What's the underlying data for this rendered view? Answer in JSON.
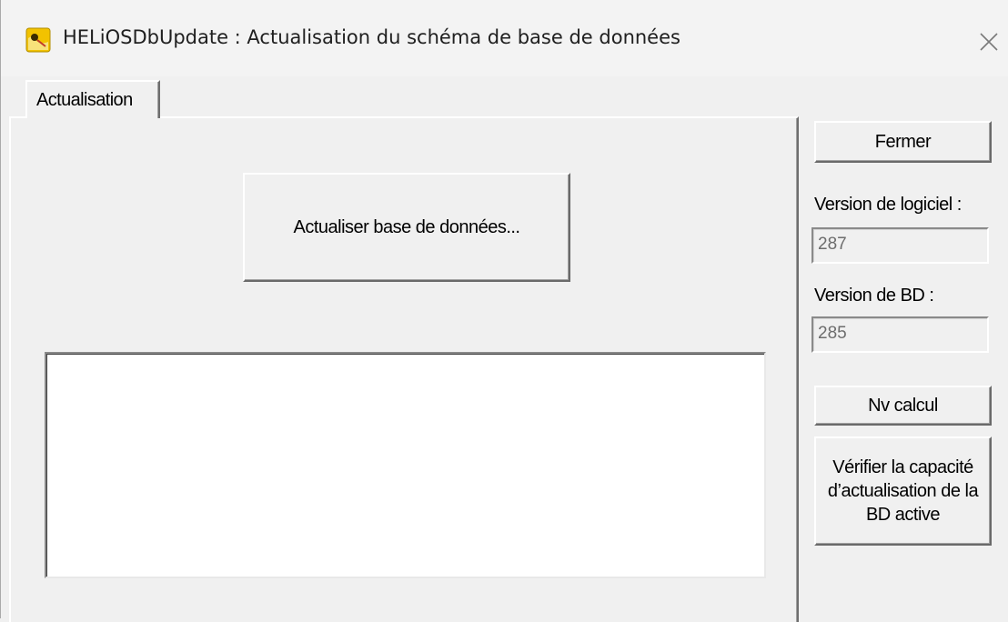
{
  "window": {
    "title": "HELiOSDbUpdate : Actualisation du schéma de base de données",
    "close_icon": "close-icon",
    "app_icon": "helios-app-icon"
  },
  "tabs": [
    {
      "label": "Actualisation",
      "selected": true
    }
  ],
  "main": {
    "update_button_label": "Actualiser base de données...",
    "log_text": ""
  },
  "side": {
    "close_button_label": "Fermer",
    "software_version_label": "Version de logiciel :",
    "software_version_value": "287",
    "db_version_label": "Version de BD :",
    "db_version_value": "285",
    "new_calc_button_label": "Nv calcul",
    "verify_button_label": "Vérifier la capacité d’actualisation de la BD active"
  },
  "colors": {
    "face": "#f0f0f0",
    "highlight": "#ffffff",
    "shadow": "#6a6a6a",
    "disabled_text": "#6d6d6d",
    "icon_yellow": "#f2c200"
  }
}
